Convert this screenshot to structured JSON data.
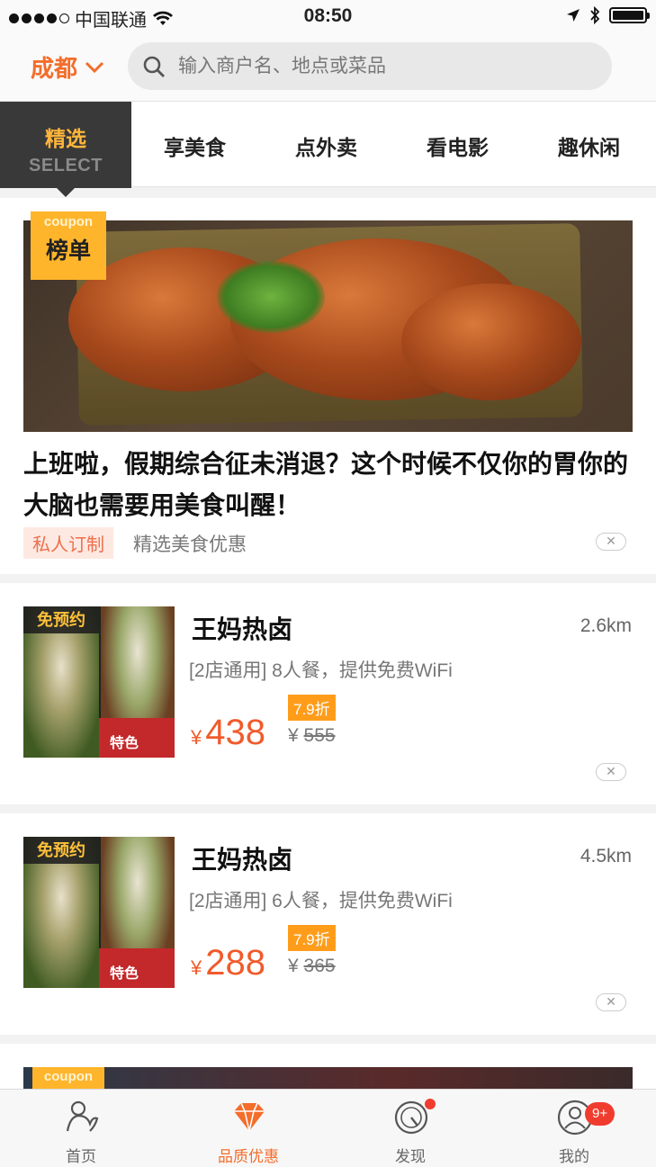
{
  "status_bar": {
    "carrier": "中国联通",
    "time": "08:50"
  },
  "header": {
    "city": "成都",
    "search_placeholder": "输入商户名、地点或菜品"
  },
  "tabs": {
    "selected": {
      "label_cn": "精选",
      "label_en": "SELECT"
    },
    "items": [
      "享美食",
      "点外卖",
      "看电影",
      "趣休闲"
    ]
  },
  "feature": {
    "coupon_en": "coupon",
    "coupon_cn": "榜单",
    "headline": "上班啦，假期综合征未消退？这个时候不仅你的胃你的大脑也需要用美食叫醒！",
    "tag": "私人订制",
    "note": "精选美食优惠"
  },
  "deals": [
    {
      "badge": "免预约",
      "thumb_text": "特色",
      "title": "王妈热卤",
      "distance": "2.6km",
      "desc": "[2店通用] 8人餐，提供免费WiFi",
      "discount": "7.9折",
      "currency": "¥",
      "price": "438",
      "original": "555"
    },
    {
      "badge": "免预约",
      "thumb_text": "特色",
      "title": "王妈热卤",
      "distance": "4.5km",
      "desc": "[2店通用] 6人餐，提供免费WiFi",
      "discount": "7.9折",
      "currency": "¥",
      "price": "288",
      "original": "365"
    }
  ],
  "next_card": {
    "coupon_en": "coupon"
  },
  "bottom_nav": [
    {
      "label": "首页",
      "icon": "home-icon"
    },
    {
      "label": "品质优惠",
      "icon": "diamond-icon",
      "active": true
    },
    {
      "label": "发现",
      "icon": "compass-icon",
      "dot": true
    },
    {
      "label": "我的",
      "icon": "profile-icon",
      "badge": "9+"
    }
  ],
  "colors": {
    "accent": "#f36d2b",
    "price": "#f05b2c",
    "coupon": "#ffb52b",
    "selected_tab_bg": "#393939"
  }
}
